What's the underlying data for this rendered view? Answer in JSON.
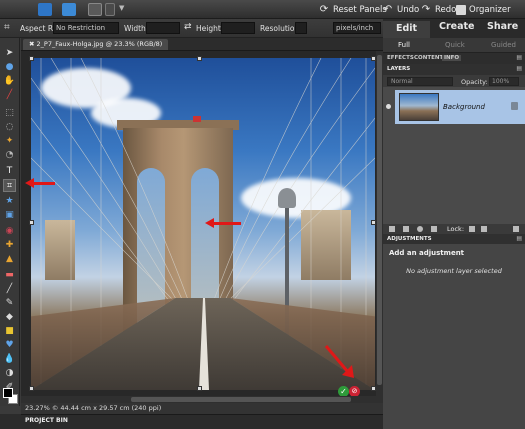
{
  "menubar": {
    "reset_label": "Reset Panels",
    "undo_label": "Undo",
    "redo_label": "Redo",
    "organizer_label": "Organizer"
  },
  "options": {
    "aspect_label": "Aspect Ratio:",
    "aspect_value": "No Restriction",
    "width_label": "Width:",
    "height_label": "Height:",
    "resolution_label": "Resolution:",
    "res_unit": "pixels/inch"
  },
  "document": {
    "tab_title": "2_P7_Faux-Holga.jpg @ 23.3% (RGB/8)",
    "status": "23.27%  © 44.44 cm x 29.57 cm (240 ppi)",
    "project_bin": "PROJECT BIN"
  },
  "modes": {
    "edit": "Edit",
    "create": "Create",
    "share": "Share",
    "sub_full": "Full",
    "sub_quick": "Quick",
    "sub_guided": "Guided"
  },
  "palettes": {
    "effects": "EFFECTS",
    "content": "CONTENT",
    "info": "INFO",
    "layers": "LAYERS",
    "blend_mode": "Normal",
    "opacity_label": "Opacity:",
    "opacity_value": "100%",
    "lock_label": "Lock:",
    "layer_name": "Background",
    "adjustments": "ADJUSTMENTS",
    "adj_title": "Add an adjustment",
    "adj_msg": "No adjustment layer selected"
  },
  "colors": {
    "accent_red": "#e01818",
    "selected_layer": "#a8c4e6"
  }
}
